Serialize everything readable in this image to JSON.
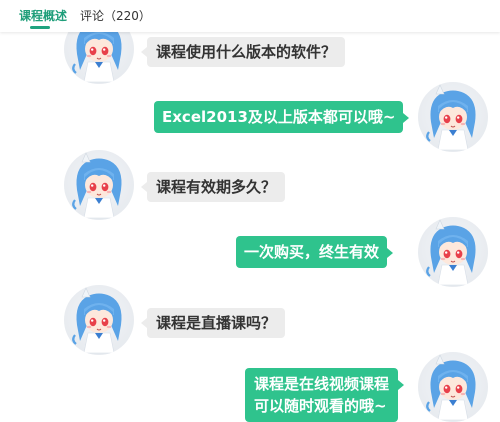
{
  "tabs": [
    {
      "label": "课程概述",
      "active": true
    },
    {
      "label": "评论（220）",
      "active": false
    }
  ],
  "accent_color": "#2fc38d",
  "faq": [
    {
      "role": "question",
      "text": "课程使用什么版本的软件？"
    },
    {
      "role": "answer",
      "text": "Excel2013及以上版本都可以哦~"
    },
    {
      "role": "question",
      "text": "课程有效期多久？"
    },
    {
      "role": "answer",
      "text": "一次购买，终生有效"
    },
    {
      "role": "question",
      "text": "课程是直播课吗？"
    },
    {
      "role": "answer",
      "lines": [
        "课程是在线视频课程",
        "可以随时观看的哦~"
      ]
    }
  ]
}
